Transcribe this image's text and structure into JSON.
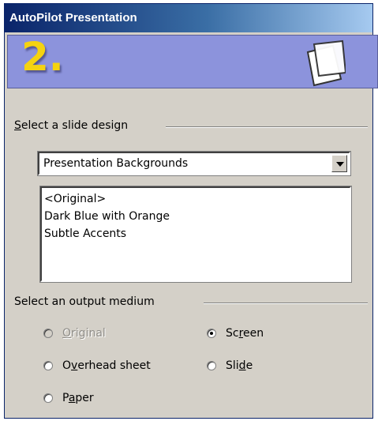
{
  "window": {
    "title": "AutoPilot Presentation"
  },
  "banner": {
    "step_number": "2.",
    "icon": "slides-illustration"
  },
  "slide_design": {
    "group_label_prefix": "",
    "group_label_mnemonic": "S",
    "group_label_rest": "elect a slide design",
    "category_select": {
      "selected": "Presentation Backgrounds"
    },
    "design_list": [
      "<Original>",
      "Dark Blue with Orange",
      "Subtle Accents"
    ]
  },
  "output_medium": {
    "group_label": "Select an output medium",
    "options": {
      "original": {
        "pre": "",
        "mnemonic": "O",
        "post": "riginal",
        "enabled": false,
        "checked": false
      },
      "screen": {
        "pre": "Sc",
        "mnemonic": "r",
        "post": "een",
        "enabled": true,
        "checked": true
      },
      "overhead": {
        "pre": "O",
        "mnemonic": "v",
        "post": "erhead sheet",
        "enabled": true,
        "checked": false
      },
      "slide": {
        "pre": "Sli",
        "mnemonic": "d",
        "post": "e",
        "enabled": true,
        "checked": false
      },
      "paper": {
        "pre": "P",
        "mnemonic": "a",
        "post": "per",
        "enabled": true,
        "checked": false
      }
    }
  },
  "colors": {
    "title_bar": "#0a246a",
    "banner": "#8c93dc",
    "step_number": "#f5d310",
    "dialog_bg": "#d4d0c8"
  }
}
